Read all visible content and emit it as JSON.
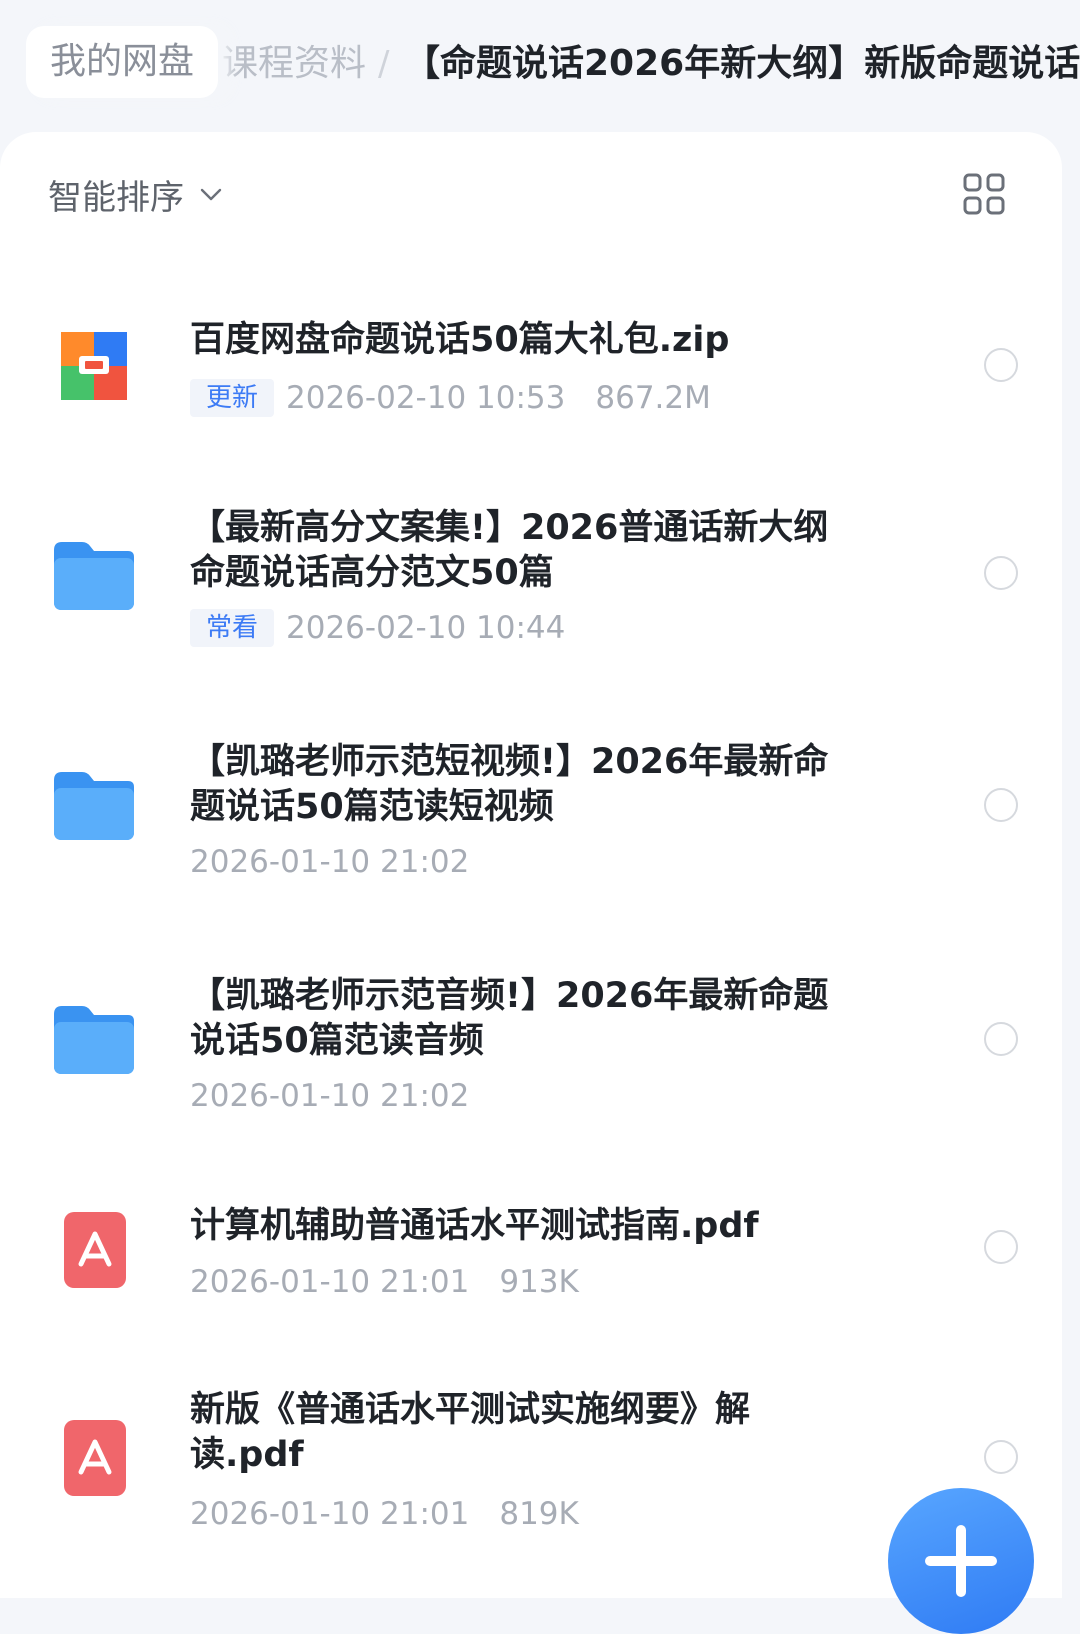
{
  "breadcrumb": {
    "root": "我的网盘",
    "middle": "课程资料",
    "separator": "/",
    "current": "【命题说话2026年新大纲】新版命题说话"
  },
  "toolbar": {
    "sort_label": "智能排序",
    "sort_icon": "chevron-down-icon",
    "view_icon": "grid-view-icon"
  },
  "files": [
    {
      "icon": "zip-archive-icon",
      "name": "百度网盘命题说话50篇大礼包.zip",
      "tag": "更新",
      "time": "2026-02-10 10:53",
      "size": "867.2M"
    },
    {
      "icon": "folder-icon",
      "name": "【最新高分文案集!】2026普通话新大纲命题说话高分范文50篇",
      "tag": "常看",
      "time": "2026-02-10 10:44",
      "size": ""
    },
    {
      "icon": "folder-icon",
      "name": "【凯璐老师示范短视频!】2026年最新命题说话50篇范读短视频",
      "tag": "",
      "time": "2026-01-10 21:02",
      "size": ""
    },
    {
      "icon": "folder-icon",
      "name": "【凯璐老师示范音频!】2026年最新命题说话50篇范读音频",
      "tag": "",
      "time": "2026-01-10 21:02",
      "size": ""
    },
    {
      "icon": "pdf-icon",
      "name": "计算机辅助普通话水平测试指南.pdf",
      "tag": "",
      "time": "2026-01-10 21:01",
      "size": "913K"
    },
    {
      "icon": "pdf-icon",
      "name": "新版《普通话水平测试实施纲要》解读.pdf",
      "tag": "",
      "time": "2026-01-10 21:01",
      "size": "819K"
    }
  ],
  "fab": {
    "icon": "plus-icon"
  },
  "colors": {
    "accent": "#3d7bf5",
    "folder": "#3f9ef6",
    "pdf": "#f0666b"
  }
}
